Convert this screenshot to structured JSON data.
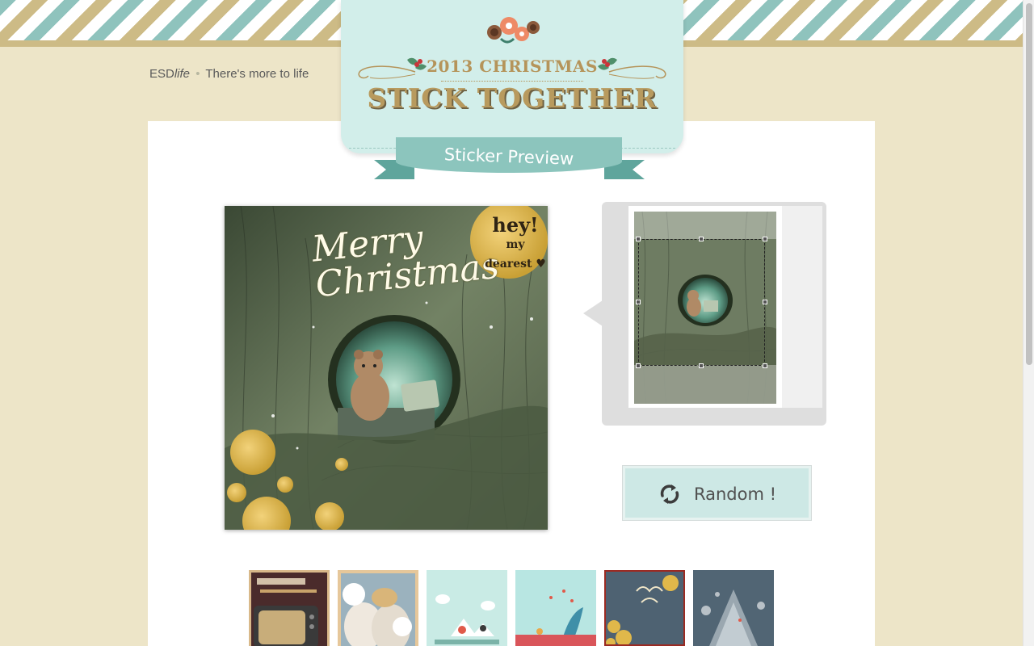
{
  "header": {
    "brand_prefix": "ESD",
    "brand_italic": "life",
    "separator": "•",
    "tagline": "There's more to life",
    "year_title": "2013 CHRISTMAS",
    "main_title": "STICK TOGETHER",
    "ribbon_label": "Sticker Preview"
  },
  "artwork": {
    "script_line1": "Merry",
    "script_line2": "Christmas",
    "badge_line1": "hey!",
    "badge_line2": "my dearest ♥"
  },
  "preview": {
    "crop_ratio": "1:1"
  },
  "actions": {
    "random_label": "Random !"
  },
  "thumbnails": [
    {
      "name": "tv-sticker",
      "selected": false
    },
    {
      "name": "alpaca-sticker",
      "selected": false
    },
    {
      "name": "birds-sticker",
      "selected": false
    },
    {
      "name": "whale-sticker",
      "selected": false
    },
    {
      "name": "merry-christmas-sticker",
      "selected": true
    },
    {
      "name": "tree-sticker",
      "selected": false
    }
  ],
  "colors": {
    "background": "#ede5c8",
    "badge": "#d2eeea",
    "ribbon": "#8cc5bd",
    "title_gold": "#b89a5e",
    "button": "#cde8e5"
  }
}
